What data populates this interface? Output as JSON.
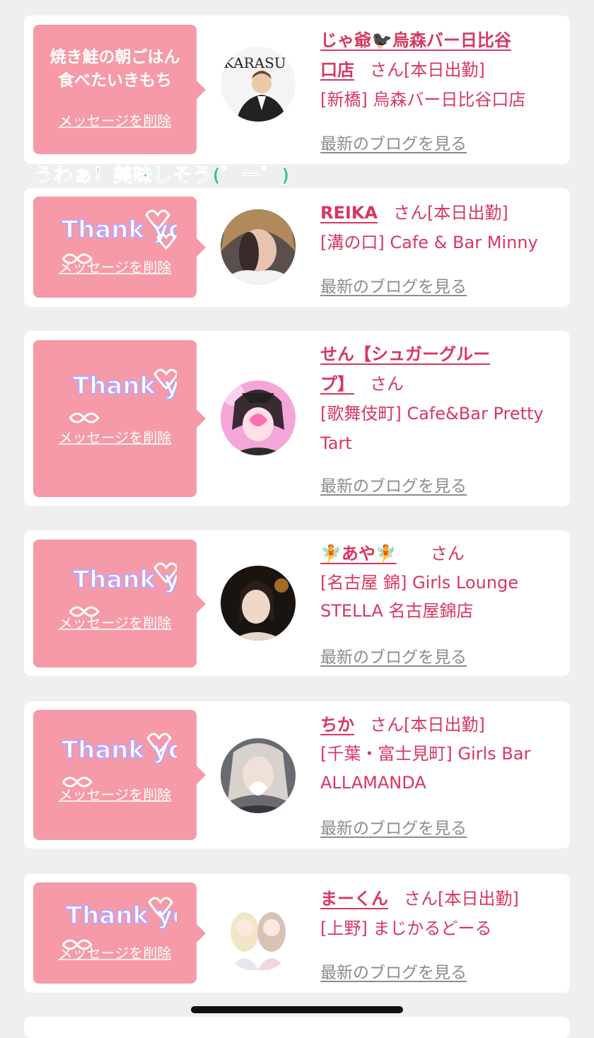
{
  "common": {
    "delete_label": "メッセージを削除",
    "blog_label": "最新のブログを見る",
    "san_suffix": "さん",
    "thanks_sticker_text": "Thank you"
  },
  "speech_text": "うわぁ！美味しそう(゜ー゜)",
  "cards": [
    {
      "message": "焼き鮭の朝ごはん食べたいきもち",
      "name": "じゃ爺🐦‍⬛烏森バー日比谷口店",
      "name_line1": "じゃ爺🐦‍⬛烏森バー日比谷",
      "name_line2": "口店",
      "status": "[本日出勤]",
      "area": "[新橋]",
      "shop": "烏森バー日比谷口店",
      "avatar_text": "KARASU MORI BAR"
    },
    {
      "message": "Thank you",
      "name": "REIKA",
      "status": "[本日出勤]",
      "area": "[溝の口]",
      "shop": "Cafe & Bar Minny"
    },
    {
      "message": "Thank you",
      "name": "せん【シュガーグループ】",
      "name_line1": "せん【シュガーグルー",
      "name_line2": "プ】",
      "status": "",
      "area": "[歌舞伎町]",
      "shop": "Cafe&Bar Pretty Tart"
    },
    {
      "message": "Thank you",
      "name": "🧚あや🧚",
      "status": "",
      "area": "[名古屋 錦]",
      "shop": "Girls Lounge STELLA 名古屋錦店"
    },
    {
      "message": "Thank you",
      "name": "ちか",
      "status": "[本日出勤]",
      "area": "[千葉・富士見町]",
      "shop": "Girls Bar ALLAMANDA"
    },
    {
      "message": "Thank you",
      "name": "まーくん",
      "status": "[本日出勤]",
      "area": "[上野]",
      "shop": "まじかるどーる"
    }
  ]
}
